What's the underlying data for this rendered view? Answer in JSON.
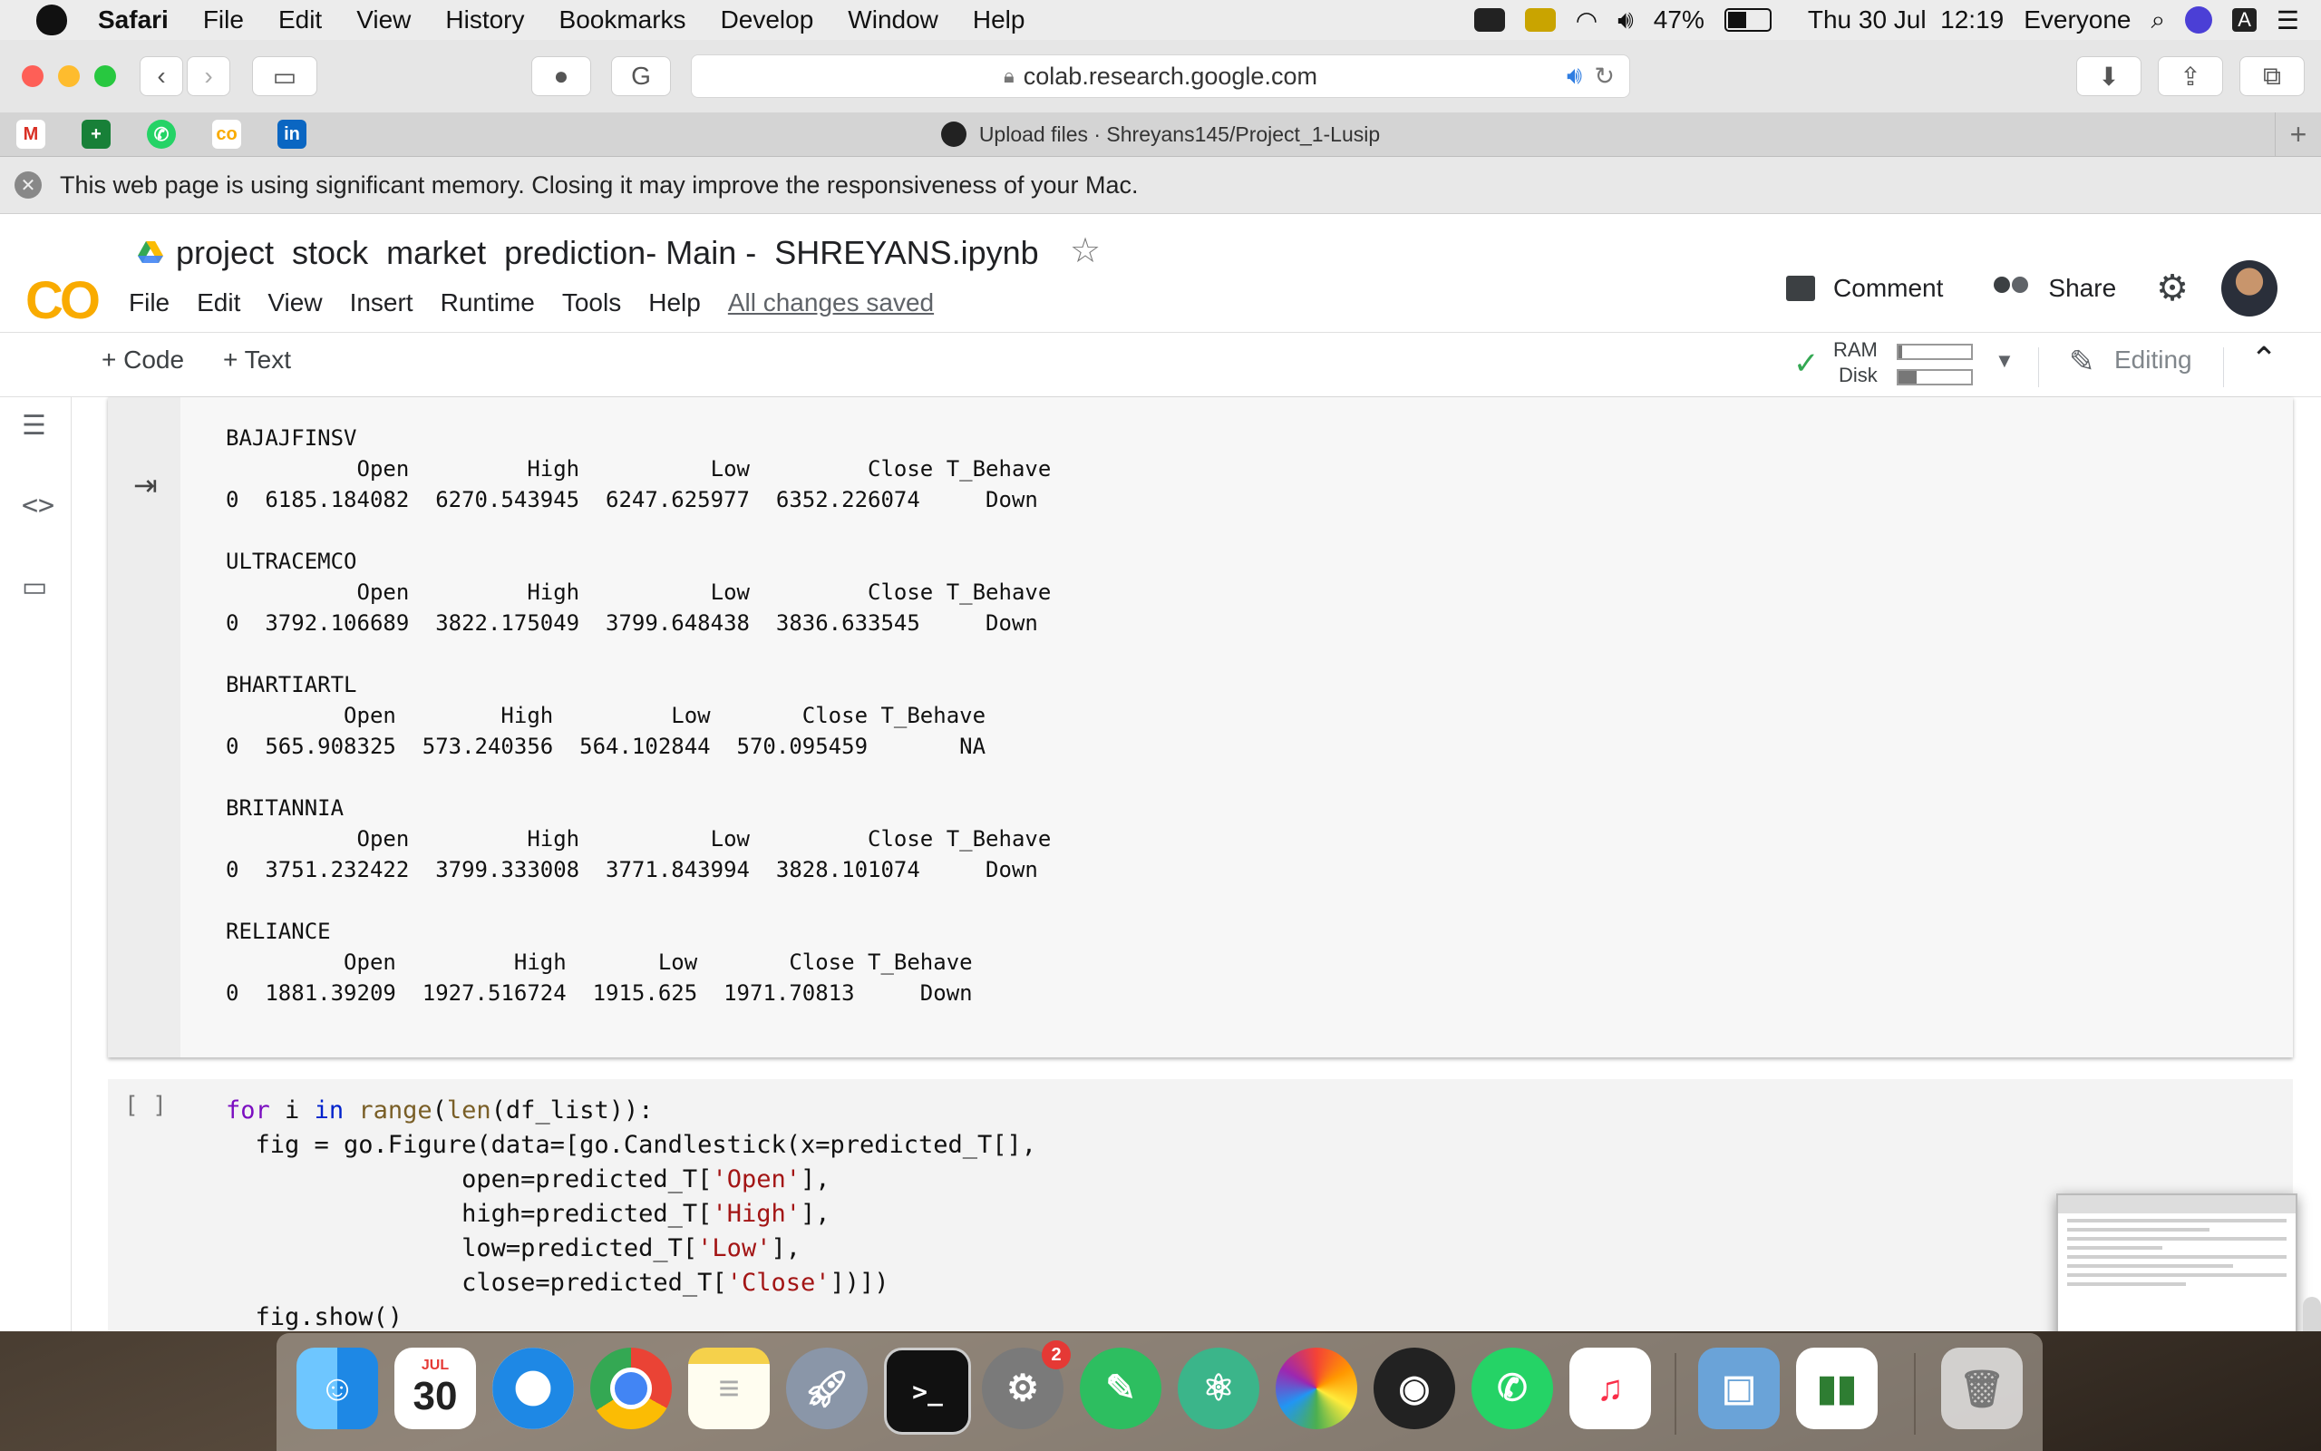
{
  "menubar": {
    "app": "Safari",
    "items": [
      "File",
      "Edit",
      "View",
      "History",
      "Bookmarks",
      "Develop",
      "Window",
      "Help"
    ],
    "battery": "47%",
    "datetime": "Thu 30 Jul  12:19",
    "user": "Everyone",
    "keyboard": "A"
  },
  "browser": {
    "url": "colab.research.google.com",
    "tab_title": "Upload files · Shreyans145/Project_1-Lusip",
    "memory_warning": "This web page is using significant memory. Closing it may improve the responsiveness of your Mac.",
    "favorites": [
      "gmail-icon",
      "sheets-icon",
      "whatsapp-icon",
      "colab-icon",
      "linkedin-icon"
    ]
  },
  "colab": {
    "logo": "CO",
    "title": "project  stock  market  prediction- Main -  SHREYANS.ipynb",
    "menu": [
      "File",
      "Edit",
      "View",
      "Insert",
      "Runtime",
      "Tools",
      "Help"
    ],
    "saved": "All changes saved",
    "comment": "Comment",
    "share": "Share",
    "add_code": "+ Code",
    "add_text": "+ Text",
    "ram_label": "RAM",
    "disk_label": "Disk",
    "ram_fraction": 0.05,
    "disk_fraction": 0.25,
    "editing": "Editing"
  },
  "output": {
    "text": "BAJAJFINSV\n          Open         High          Low         Close T_Behave\n0  6185.184082  6270.543945  6247.625977  6352.226074     Down\n\nULTRACEMCO\n          Open         High          Low         Close T_Behave\n0  3792.106689  3822.175049  3799.648438  3836.633545     Down\n\nBHARTIARTL\n         Open        High         Low       Close T_Behave\n0  565.908325  573.240356  564.102844  570.095459       NA\n\nBRITANNIA\n          Open         High          Low         Close T_Behave\n0  3751.232422  3799.333008  3771.843994  3828.101074     Down\n\nRELIANCE\n         Open         High       Low       Close T_Behave\n0  1881.39209  1927.516724  1915.625  1971.70813     Down"
  },
  "code_cell": {
    "run_bracket": "[ ]",
    "lines": [
      "for i in range(len(df_list)):",
      "  fig = go.Figure(data=[go.Candlestick(x=predicted_T[],",
      "                open=predicted_T['Open'],",
      "                high=predicted_T['High'],",
      "                low=predicted_T['Low'],",
      "                close=predicted_T['Close'])])",
      "  fig.show()"
    ]
  },
  "dock": {
    "apps": [
      "finder-icon",
      "calendar-icon",
      "safari-icon",
      "chrome-icon",
      "notes-icon",
      "launchpad-icon",
      "terminal-icon",
      "system-preferences-icon",
      "evernote-icon",
      "atom-icon",
      "photos-icon",
      "obs-icon",
      "whatsapp-icon",
      "music-icon",
      "preview-icon",
      "numbers-icon",
      "trash-icon"
    ],
    "calendar_month": "JUL",
    "calendar_day": "30",
    "badge": "2"
  }
}
